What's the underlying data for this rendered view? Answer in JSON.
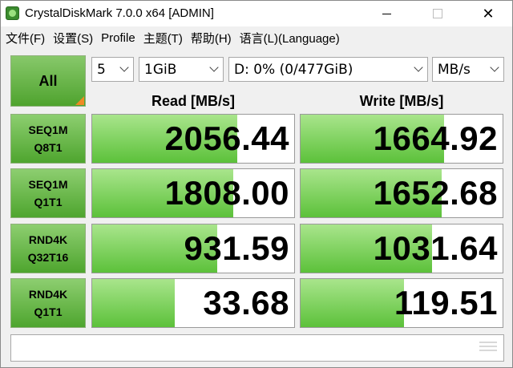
{
  "window": {
    "title": "CrystalDiskMark 7.0.0 x64 [ADMIN]",
    "controls": {
      "minimize": "—",
      "maximize": "□",
      "close": "✕"
    }
  },
  "menu": [
    "文件(F)",
    "设置(S)",
    "Profile",
    "主题(T)",
    "帮助(H)",
    "语言(L)(Language)"
  ],
  "controls": {
    "all_label": "All",
    "count": "5",
    "size": "1GiB",
    "drive": "D: 0% (0/477GiB)",
    "unit": "MB/s"
  },
  "headers": {
    "read": "Read [MB/s]",
    "write": "Write [MB/s]"
  },
  "rows": [
    {
      "label_line1": "SEQ1M",
      "label_line2": "Q8T1",
      "read": "2056.44",
      "write": "1664.92"
    },
    {
      "label_line1": "SEQ1M",
      "label_line2": "Q1T1",
      "read": "1808.00",
      "write": "1652.68"
    },
    {
      "label_line1": "RND4K",
      "label_line2": "Q32T16",
      "read": "931.59",
      "write": "1031.64"
    },
    {
      "label_line1": "RND4K",
      "label_line2": "Q1T1",
      "read": "33.68",
      "write": "119.51"
    }
  ],
  "bar_levels": {
    "read": [
      0.72,
      0.7,
      0.62,
      0.41
    ],
    "write": [
      0.71,
      0.7,
      0.65,
      0.51
    ]
  },
  "colors": {
    "bar_green": "#5cc13a",
    "label_green": "#4ea52e",
    "corner_orange": "#f08a24"
  },
  "comment": ""
}
